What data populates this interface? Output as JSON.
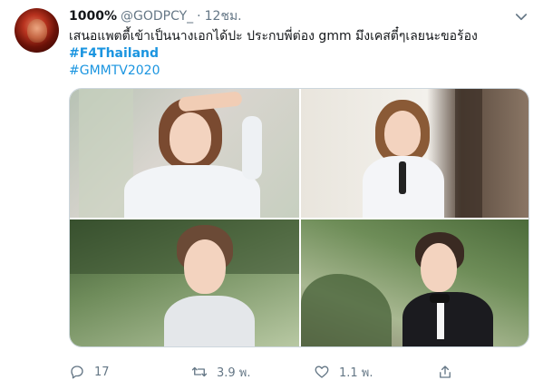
{
  "tweet": {
    "display_name": "1000%",
    "handle": "@GODPCY_",
    "separator": "·",
    "time": "12ชม.",
    "text": "เสนอแพตตี้เข้าเป็นนางเอกได้ปะ ประกบพี่ต่อง gmm มึงเคสตี๋ๆเลยนะขอร้อง",
    "hashtags": [
      "#F4Thailand",
      "#GMMTV2020"
    ],
    "photos": [
      "photo-1",
      "photo-2",
      "photo-3",
      "photo-4"
    ],
    "counts": {
      "reply": "17",
      "retweet": "3.9 พ.",
      "like": "1.1 พ."
    }
  },
  "colors": {
    "text": "#14171a",
    "secondary": "#657786",
    "link": "#1b95e0",
    "border": "#ccd6dd"
  },
  "icons": [
    "chevron-down-icon",
    "reply-icon",
    "retweet-icon",
    "like-icon",
    "share-icon"
  ]
}
